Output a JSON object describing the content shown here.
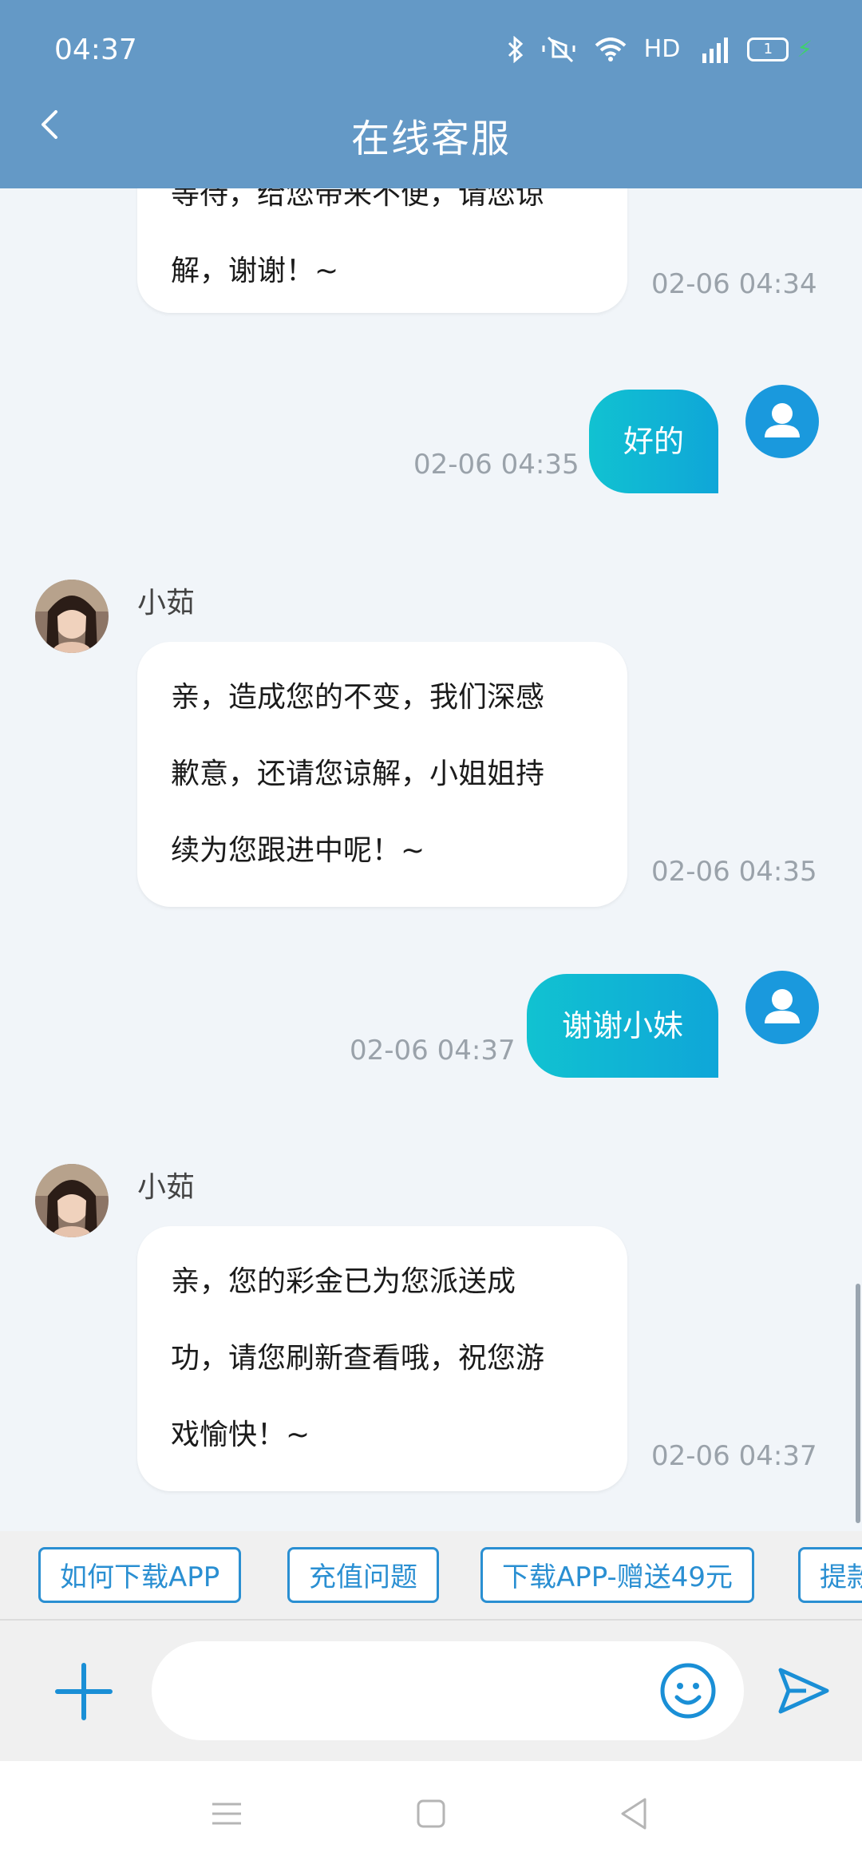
{
  "status_bar": {
    "time": "04:37",
    "network_label": "HD",
    "battery_level": "1"
  },
  "header": {
    "title": "在线客服"
  },
  "messages": [
    {
      "partial_text": "等待，给您带来不便，请您谅",
      "text_line": "解，谢谢！~",
      "time": "02-06 04:34"
    },
    {
      "text": "好的",
      "time": "02-06 04:35"
    },
    {
      "sender": "小茹",
      "text": "亲，造成您的不变，我们深感歉意，还请您谅解，小姐姐持续为您跟进中呢！~",
      "lines": [
        "亲，造成您的不变，我们深感",
        "歉意，还请您谅解，小姐姐持",
        "续为您跟进中呢！~"
      ],
      "time": "02-06 04:35"
    },
    {
      "text": "谢谢小妹",
      "time": "02-06 04:37"
    },
    {
      "sender": "小茹",
      "text": "亲，您的彩金已为您派送成功，请您刷新查看哦，祝您游戏愉快！~",
      "lines": [
        "亲，您的彩金已为您派送成",
        "功，请您刷新查看哦，祝您游",
        "戏愉快！~"
      ],
      "time": "02-06 04:37"
    }
  ],
  "quick_replies": [
    "如何下载APP",
    "充值问题",
    "下载APP-赠送49元",
    "提款"
  ],
  "input": {
    "placeholder": ""
  },
  "colors": {
    "header": "#6499c6",
    "accent": "#2a8fd2",
    "user_bubble_start": "#11c2d1",
    "user_bubble_end": "#0fa6d8",
    "avatar_user": "#1a99dd"
  },
  "icons": [
    "back-icon",
    "bluetooth-icon",
    "mute-icon",
    "wifi-icon",
    "signal-icon",
    "battery-icon",
    "user-avatar-icon",
    "plus-icon",
    "emoji-icon",
    "send-icon",
    "menu-icon",
    "home-icon",
    "back-nav-icon"
  ]
}
